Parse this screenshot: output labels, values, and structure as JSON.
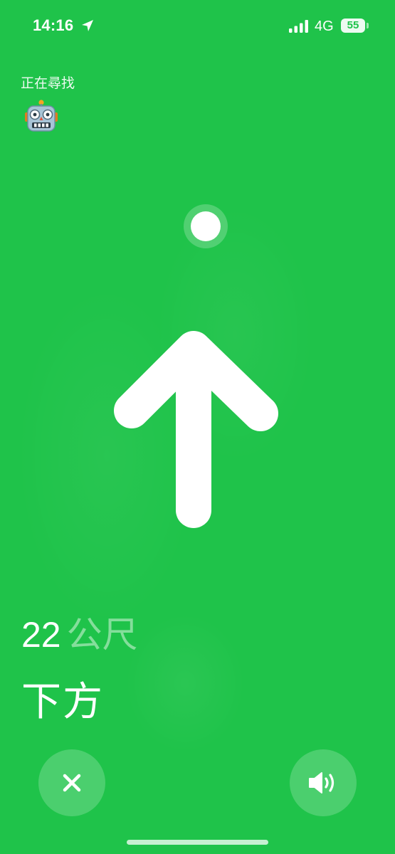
{
  "status_bar": {
    "time": "14:16",
    "location_icon": "location-arrow-icon",
    "signal_icon": "cellular-signal-icon",
    "network": "4G",
    "battery_level": "55"
  },
  "header": {
    "finding_label": "正在尋找",
    "item_icon": "robot-face-emoji"
  },
  "navigation": {
    "target_dot_icon": "target-dot",
    "arrow_icon": "up-arrow-icon",
    "distance_value": "22",
    "distance_unit": "公尺",
    "direction": "下方"
  },
  "controls": {
    "close_icon": "close-icon",
    "sound_icon": "speaker-icon"
  },
  "colors": {
    "background": "#1fc34a",
    "foreground": "#ffffff"
  }
}
